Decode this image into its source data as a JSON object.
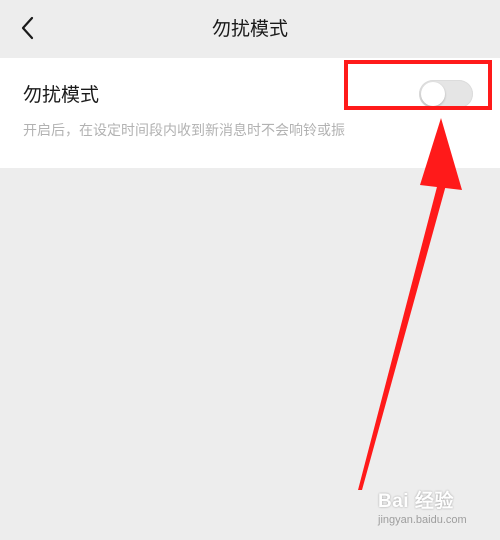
{
  "header": {
    "title": "勿扰模式"
  },
  "setting": {
    "label": "勿扰模式",
    "description": "开启后，在设定时间段内收到新消息时不会响铃或振",
    "toggle_on": false
  },
  "annotation": {
    "color": "#ff1a1a"
  },
  "watermark": {
    "text": "Bai 经验",
    "url": "jingyan.baidu.com"
  },
  "colors": {
    "background": "#ededed",
    "card": "#ffffff",
    "toggle_off": "#e5e5e5",
    "text_primary": "#1a1a1a",
    "text_secondary": "#b2b2b2"
  }
}
